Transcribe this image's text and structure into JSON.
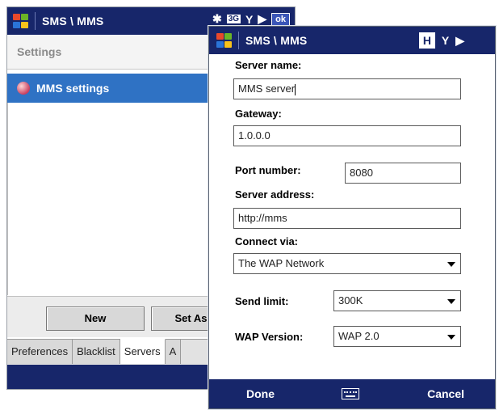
{
  "back_window": {
    "title": "SMS \\ MMS",
    "ok_label": "ok",
    "network_label": "3G",
    "settings_header": "Settings",
    "list_items": [
      {
        "label": "MMS settings",
        "icon": "globe-icon"
      }
    ],
    "buttons": {
      "new_label": "New",
      "set_default_label": "Set As D"
    },
    "tabs": [
      "Preferences",
      "Blacklist",
      "Servers",
      "A"
    ]
  },
  "dialog": {
    "title": "SMS \\ MMS",
    "fields": {
      "server_name": {
        "label": "Server name:",
        "value": "MMS server"
      },
      "gateway": {
        "label": "Gateway:",
        "value": "1.0.0.0"
      },
      "port": {
        "label": "Port number:",
        "value": "8080"
      },
      "server_address": {
        "label": "Server address:",
        "value": "http://mms"
      },
      "connect_via": {
        "label": "Connect via:",
        "value": "The WAP Network"
      },
      "send_limit": {
        "label": "Send limit:",
        "value": "300K"
      },
      "wap_version": {
        "label": "WAP Version:",
        "value": "WAP 2.0"
      }
    },
    "softkeys": {
      "left": "Done",
      "right": "Cancel",
      "middle_icon": "keyboard-icon"
    }
  },
  "colors": {
    "titlebar": "#17266a",
    "selection": "#2f72c4"
  }
}
